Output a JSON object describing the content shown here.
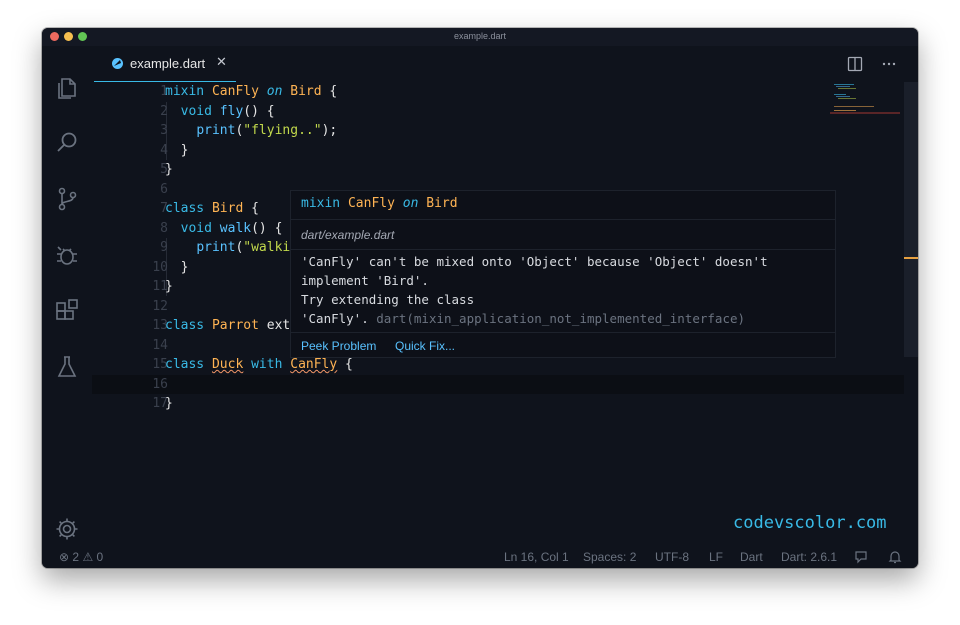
{
  "window": {
    "title": "example.dart"
  },
  "tab": {
    "label": "example.dart",
    "close": "✕"
  },
  "code": {
    "lines": [
      {
        "num": "1",
        "tokens": [
          [
            "kw",
            "mixin "
          ],
          [
            "cls",
            "CanFly "
          ],
          [
            "on",
            "on "
          ],
          [
            "cls",
            "Bird "
          ],
          [
            "",
            "{"
          ]
        ]
      },
      {
        "num": "2",
        "tokens": [
          [
            "",
            "  "
          ],
          [
            "kw",
            "void "
          ],
          [
            "fn",
            "fly"
          ],
          [
            "",
            "() {"
          ]
        ]
      },
      {
        "num": "3",
        "tokens": [
          [
            "",
            "    "
          ],
          [
            "fn",
            "print"
          ],
          [
            "",
            "("
          ],
          [
            "str",
            "\"flying..\""
          ],
          [
            "",
            ");"
          ]
        ]
      },
      {
        "num": "4",
        "tokens": [
          [
            "",
            "  }"
          ]
        ]
      },
      {
        "num": "5",
        "tokens": [
          [
            "",
            "}"
          ]
        ]
      },
      {
        "num": "6",
        "tokens": []
      },
      {
        "num": "7",
        "tokens": [
          [
            "kw",
            "class "
          ],
          [
            "cls",
            "Bird "
          ],
          [
            "",
            "{"
          ]
        ]
      },
      {
        "num": "8",
        "tokens": [
          [
            "",
            "  "
          ],
          [
            "kw",
            "void "
          ],
          [
            "fn",
            "walk"
          ],
          [
            "",
            "() {"
          ]
        ]
      },
      {
        "num": "9",
        "tokens": [
          [
            "",
            "    "
          ],
          [
            "fn",
            "print"
          ],
          [
            "",
            "("
          ],
          [
            "str",
            "\"walki"
          ]
        ]
      },
      {
        "num": "10",
        "tokens": [
          [
            "",
            "  }"
          ]
        ]
      },
      {
        "num": "11",
        "tokens": [
          [
            "",
            "}"
          ]
        ]
      },
      {
        "num": "12",
        "tokens": []
      },
      {
        "num": "13",
        "tokens": [
          [
            "kw",
            "class "
          ],
          [
            "cls",
            "Parrot "
          ],
          [
            "",
            "ext"
          ]
        ]
      },
      {
        "num": "14",
        "tokens": []
      },
      {
        "num": "15",
        "tokens": [
          [
            "kw",
            "class "
          ],
          [
            "cls squig",
            "Duck"
          ],
          [
            "",
            " "
          ],
          [
            "kw",
            "with "
          ],
          [
            "cls squig",
            "CanFly"
          ],
          [
            "",
            " {"
          ]
        ]
      },
      {
        "num": "16",
        "tokens": []
      },
      {
        "num": "17",
        "tokens": [
          [
            "",
            "}"
          ]
        ]
      }
    ]
  },
  "hover": {
    "signature_parts": [
      [
        "kw",
        "mixin "
      ],
      [
        "cls",
        "CanFly "
      ],
      [
        "on",
        "on "
      ],
      [
        "cls",
        "Bird"
      ]
    ],
    "file": "dart/example.dart",
    "message_lines": [
      "'CanFly' can't be mixed onto 'Object' because 'Object' doesn't",
      "implement 'Bird'.",
      "Try extending the class"
    ],
    "message_last": "'CanFly'. ",
    "error_code": "dart(mixin_application_not_implemented_interface)",
    "peek_label": "Peek Problem",
    "quickfix_label": "Quick Fix..."
  },
  "watermark": "codevscolor.com",
  "status": {
    "errors": "2",
    "warnings": "0",
    "position": "Ln 16, Col 1",
    "spaces": "Spaces: 2",
    "encoding": "UTF-8",
    "eol": "LF",
    "language": "Dart",
    "sdk": "Dart: 2.6.1"
  },
  "colors": {
    "background": "#0f131c",
    "keyword": "#39bae6",
    "class": "#ffb454",
    "string": "#c2d94c",
    "function": "#59c2ff"
  }
}
